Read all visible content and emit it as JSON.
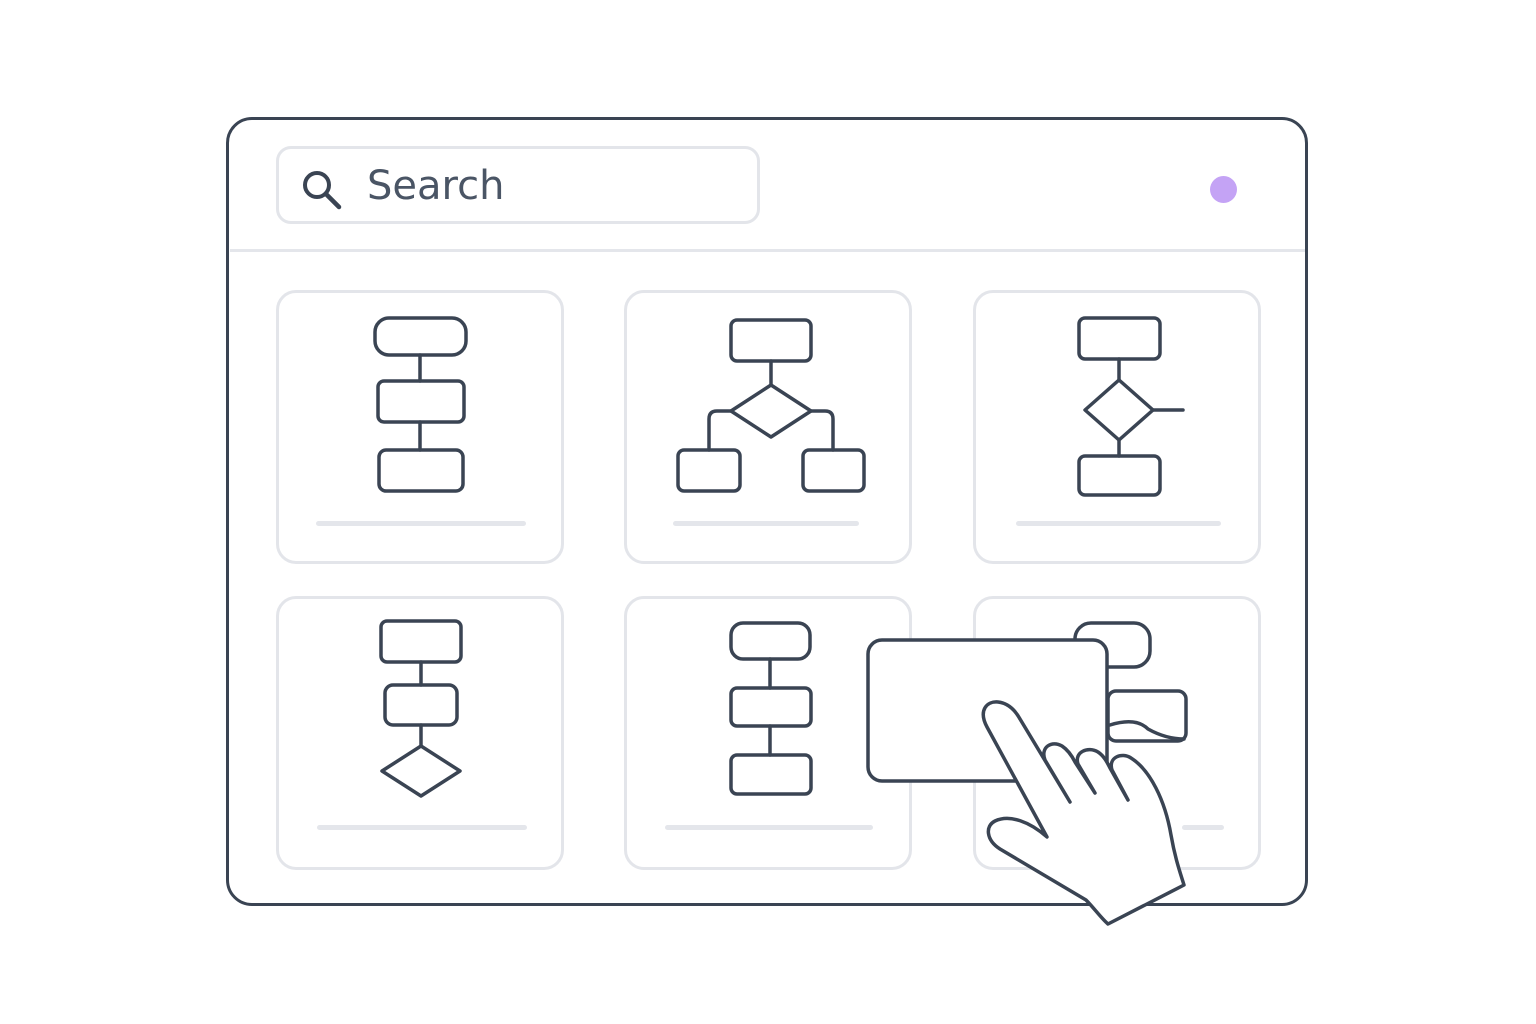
{
  "search": {
    "placeholder": "Search",
    "icon": "magnifier"
  },
  "status_indicator": {
    "color": "#c4a3f5"
  },
  "colors": {
    "stroke": "#3a4453",
    "border_light": "#e3e5ea",
    "accent": "#c4a3f5"
  },
  "templates": [
    {
      "diagram": "vertical-three-step-flow"
    },
    {
      "diagram": "decision-branch-tree"
    },
    {
      "diagram": "decision-with-side-exit"
    },
    {
      "diagram": "two-steps-then-decision"
    },
    {
      "diagram": "vertical-three-step-flow"
    },
    {
      "diagram": "flow-being-dragged"
    }
  ],
  "drag": {
    "state": "dragging",
    "pointer": "hand-pointer-icon"
  }
}
